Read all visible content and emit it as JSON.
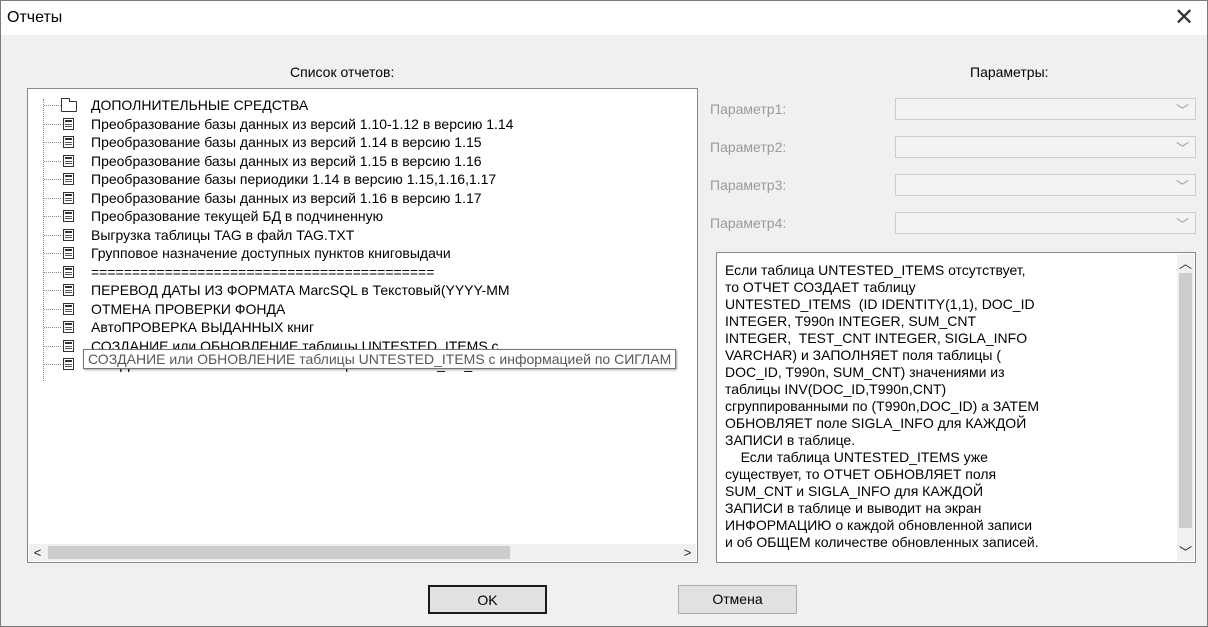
{
  "window": {
    "title": "Отчеты",
    "close_glyph": "✕"
  },
  "list_header": "Список отчетов:",
  "params_header": "Параметры:",
  "reports": [
    {
      "label": "ДОПОЛНИТЕЛЬНЫЕ СРЕДСТВА",
      "icon": "folder-icon"
    },
    {
      "label": "Преобразование базы данных из версий 1.10-1.12 в версию 1.14",
      "icon": "report-icon"
    },
    {
      "label": "Преобразование базы данных из версий 1.14 в версию 1.15",
      "icon": "report-icon"
    },
    {
      "label": "Преобразование базы данных из версий 1.15 в версию 1.16",
      "icon": "report-icon"
    },
    {
      "label": "Преобразование базы периодики  1.14 в версию 1.15,1.16,1.17",
      "icon": "report-icon"
    },
    {
      "label": "Преобразование базы данных из версий 1.16 в версию 1.17",
      "icon": "report-icon"
    },
    {
      "label": "Преобразование текущей БД в подчиненную",
      "icon": "report-icon"
    },
    {
      "label": "Выгрузка таблицы TAG в файл TAG.TXT",
      "icon": "report-icon"
    },
    {
      "label": "Групповое назначение доступных пунктов книговыдачи",
      "icon": "report-icon"
    },
    {
      "label": "==========================================",
      "icon": "report-icon"
    },
    {
      "label": "ПЕРЕВОД  ДАТЫ ИЗ ФОРМАТА MarcSQL в Текстовый(YYYY-MM",
      "icon": "report-icon"
    },
    {
      "label": "ОТМЕНА ПРОВЕРКИ ФОНДА",
      "icon": "report-icon"
    },
    {
      "label": "АвтоПРОВЕРКА ВЫДАННЫХ книг",
      "icon": "report-icon"
    },
    {
      "label": "СОЗДАНИЕ или ОБНОВЛЕНИЕ таблицы UNTESTED_ITEMS с",
      "icon": "report-icon"
    },
    {
      "label": "СОЗДАНИЕ или ОБНОВЛЕНИЕ таблицы UNTESTED_BN_ITEMS с",
      "icon": "report-icon"
    }
  ],
  "tooltip": "СОЗДАНИЕ или ОБНОВЛЕНИЕ таблицы UNTESTED_ITEMS с информацией по СИГЛАМ",
  "params": [
    {
      "label": "Параметр1:",
      "value": ""
    },
    {
      "label": "Параметр2:",
      "value": ""
    },
    {
      "label": "Параметр3:",
      "value": ""
    },
    {
      "label": "Параметр4:",
      "value": ""
    }
  ],
  "description": "Если таблица UNTESTED_ITEMS отсутствует,\nто ОТЧЕТ СОЗДАЕТ таблицу\nUNTESTED_ITEMS  (ID IDENTITY(1,1), DOC_ID\nINTEGER, T990n INTEGER, SUM_CNT\nINTEGER,  TEST_CNT INTEGER, SIGLA_INFO\nVARCHAR) и ЗАПОЛНЯЕТ поля таблицы (\nDOC_ID, T990n, SUM_CNT) значениями из\nтаблицы INV(DOC_ID,T990n,CNT)\nсгруппированными по (T990n,DOC_ID) а ЗАТЕМ\nОБНОВЛЯЕТ поле SIGLA_INFO для КАЖДОЙ\nЗАПИСИ в таблице.\n    Если таблица UNTESTED_ITEMS уже\nсуществует, то ОТЧЕТ ОБНОВЛЯЕТ поля\nSUM_CNT и SIGLA_INFO для КАЖДОЙ\nЗАПИСИ в таблице и выводит на экран\nИНФОРМАЦИЮ о каждой обновленной записи\nи об ОБЩЕМ количестве обновленных записей.",
  "buttons": {
    "ok": "OK",
    "cancel": "Отмена"
  }
}
